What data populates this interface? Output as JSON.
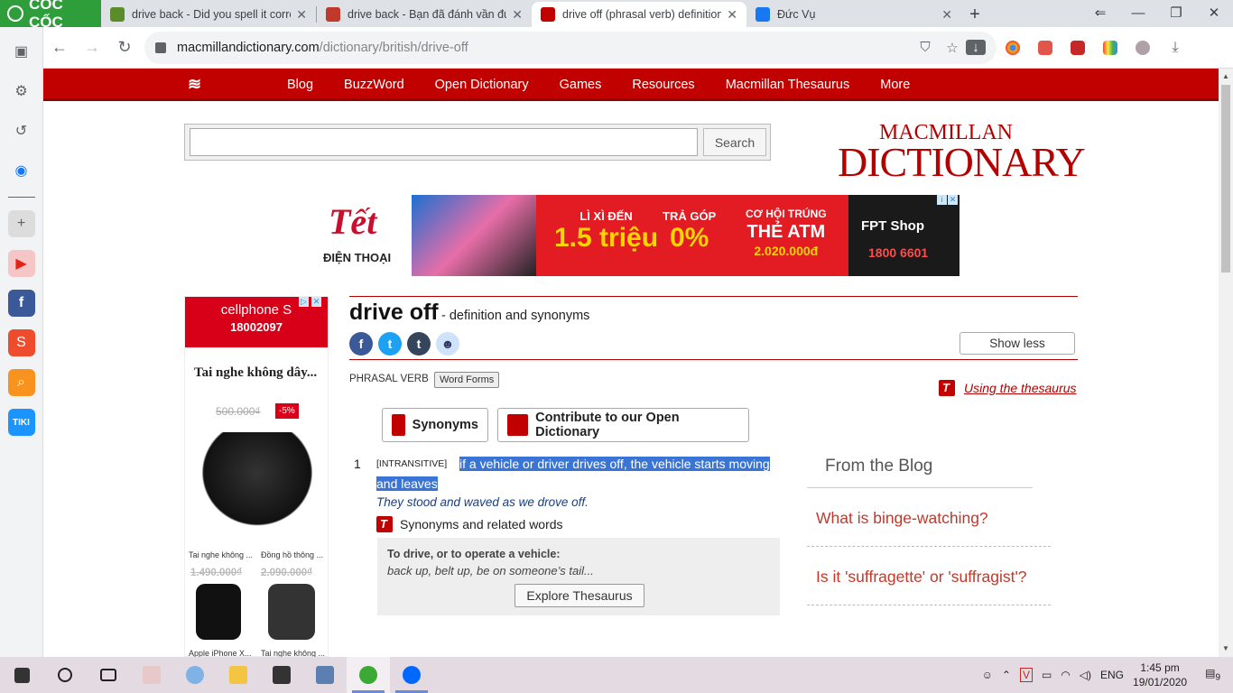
{
  "browser": {
    "brand": "CỐC CỐC",
    "tabs": [
      {
        "title": "drive back - Did you spell it correc",
        "color": "#5b8c2a"
      },
      {
        "title": "drive back - Bạn đã đánh vần đúng",
        "color": "#c0392b"
      },
      {
        "title": "drive off (phrasal verb) definition a",
        "color": "#c10000"
      },
      {
        "title": "Đức Vụ",
        "color": "#1877f2"
      }
    ],
    "url_host": "macmillandictionary.com",
    "url_path": "/dictionary/british/drive-off"
  },
  "site": {
    "nav": [
      "Blog",
      "BuzzWord",
      "Open Dictionary",
      "Games",
      "Resources",
      "Macmillan Thesaurus",
      "More"
    ],
    "search_button": "Search",
    "logo_line1": "MACMILLAN",
    "logo_line2": "DICTIONARY"
  },
  "banner_ad": {
    "tet": "Tết",
    "dien_thoai": "ĐIỆN THOẠI",
    "promo1_t": "LÌ XÌ ĐẾN",
    "promo1_v": "1.5 triệu",
    "promo2_t": "TRẢ GÓP",
    "promo2_v": "0%",
    "promo3_t": "CƠ HỘI TRÚNG",
    "promo3_v": "THẺ ATM",
    "promo3_s": "2.020.000đ",
    "fpt": "FPT Shop",
    "phone": "1800 6601"
  },
  "side_ad": {
    "brand": "cellphone S",
    "phone": "18002097",
    "title": "Tai nghe không dây...",
    "old_price": "500.000₫",
    "discount": "-5%",
    "p1": "Tai nghe không ...",
    "p2": "Đồng hồ thông ...",
    "p1_price": "1.490.000₫",
    "p2_price": "2.090.000₫",
    "p3": "Apple iPhone X...",
    "p4": "Tai nghe không ..."
  },
  "entry": {
    "headword": "drive off",
    "subtitle": "- definition and synonyms",
    "show_less": "Show less",
    "pos": "PHRASAL VERB",
    "word_forms": "Word Forms",
    "using_thesaurus": "Using the thesaurus",
    "synonyms_btn": "Synonyms",
    "contribute_btn": "Contribute to our Open Dictionary",
    "sense_num": "1",
    "grammar": "[INTRANSITIVE]",
    "definition": "if a vehicle or driver drives off, the vehicle starts moving and leaves",
    "example": "They stood and waved as we drove off.",
    "syn_related": "Synonyms and related words",
    "thes_heading": "To drive, or to operate a vehicle:",
    "thes_words": "back up, belt up, be on someone’s tail...",
    "explore": "Explore Thesaurus"
  },
  "blog": {
    "heading": "From the Blog",
    "items": [
      "What is binge-watching?",
      "Is it 'suffragette' or 'suffragist'?"
    ]
  },
  "taskbar": {
    "lang": "ENG",
    "time": "1:45 pm",
    "date": "19/01/2020",
    "notif": "9"
  }
}
